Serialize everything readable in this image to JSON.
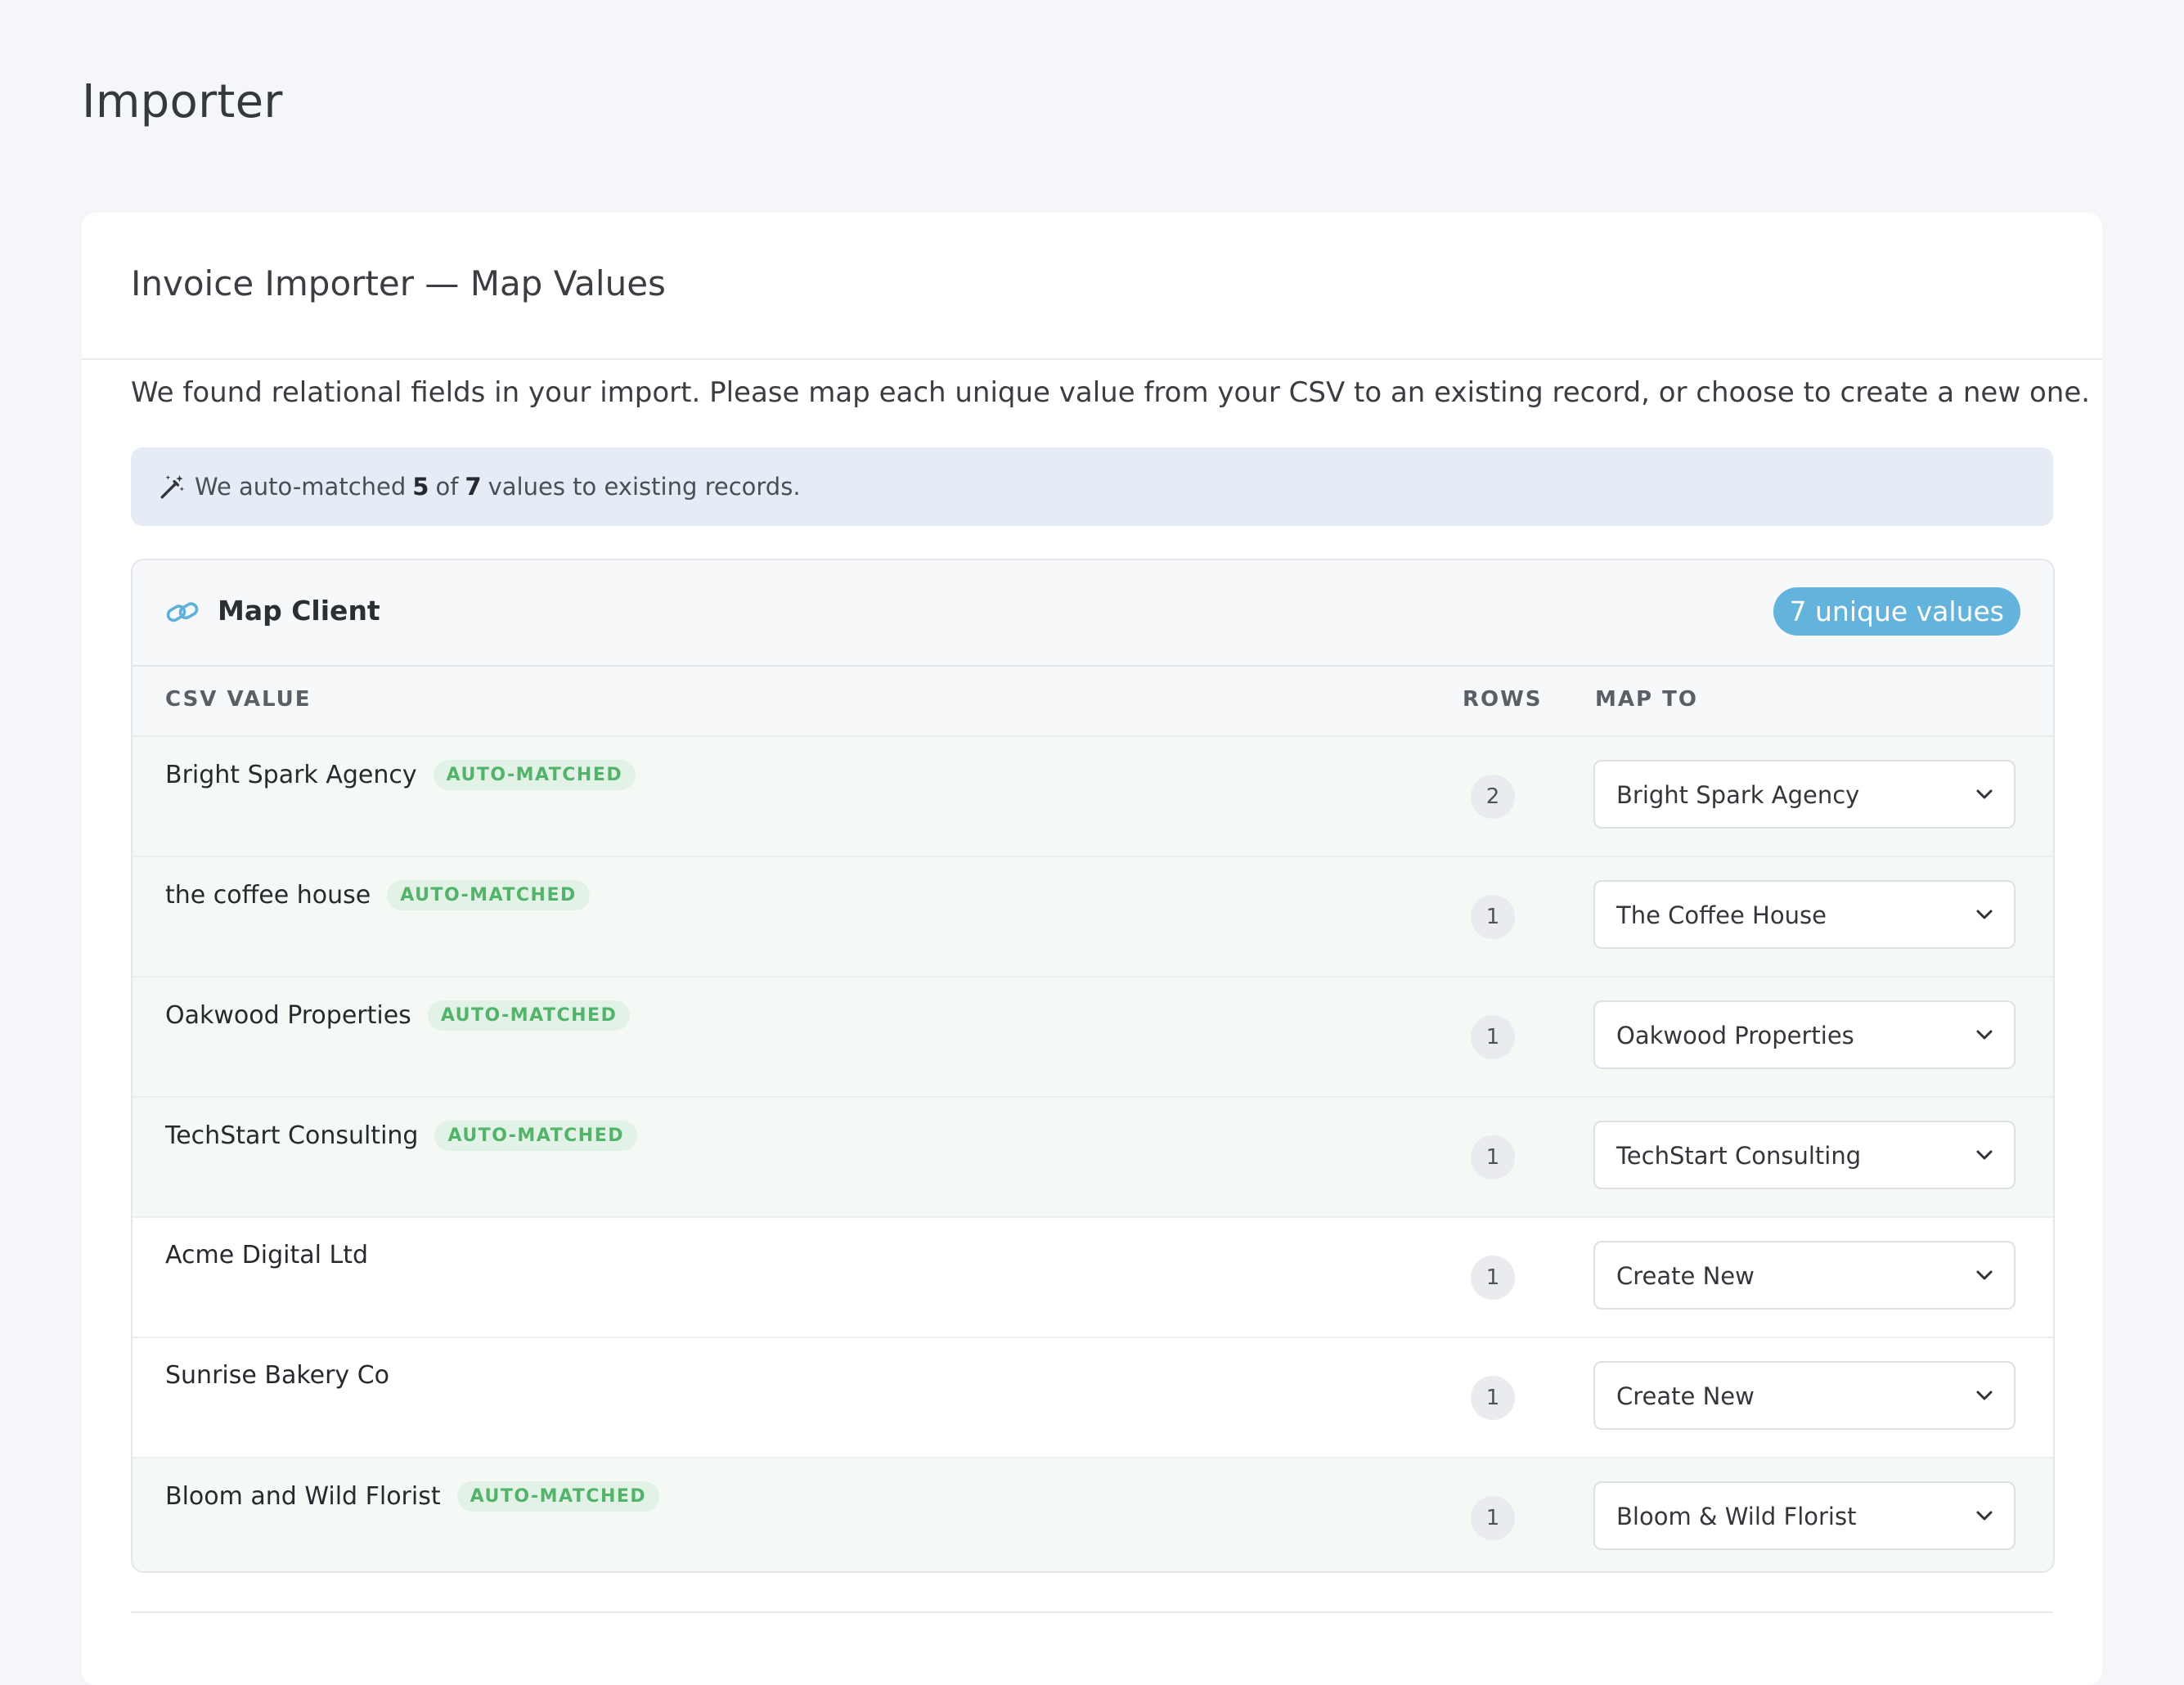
{
  "page": {
    "title": "Importer"
  },
  "card": {
    "title": "Invoice Importer — Map Values",
    "intro": "We found relational fields in your import. Please map each unique value from your CSV to an existing record, or choose to create a new one."
  },
  "alert": {
    "icon": "magic-wand-icon",
    "prefix": "We auto-matched",
    "matched": "5",
    "middle": "of",
    "total": "7",
    "suffix": "values to existing records."
  },
  "panel": {
    "icon": "link-icon",
    "title": "Map Client",
    "badge": "7 unique values",
    "columns": {
      "csv": "CSV VALUE",
      "rows": "ROWS",
      "map_to": "MAP TO"
    },
    "auto_tag": "AUTO-MATCHED",
    "rows": [
      {
        "csv": "Bright Spark Agency",
        "matched": true,
        "tag": "AUTO-MATCHED",
        "count": "2",
        "map_to": "Bright Spark Agency"
      },
      {
        "csv": "the coffee house",
        "matched": true,
        "tag": "AUTO-MATCHED",
        "count": "1",
        "map_to": "The Coffee House"
      },
      {
        "csv": "Oakwood Properties",
        "matched": true,
        "tag": "AUTO-MATCHED",
        "count": "1",
        "map_to": "Oakwood Properties"
      },
      {
        "csv": "TechStart Consulting",
        "matched": true,
        "tag": "AUTO-MATCHED",
        "count": "1",
        "map_to": "TechStart Consulting"
      },
      {
        "csv": "Acme Digital Ltd",
        "matched": false,
        "tag": "",
        "count": "1",
        "map_to": "Create New"
      },
      {
        "csv": "Sunrise Bakery Co",
        "matched": false,
        "tag": "",
        "count": "1",
        "map_to": "Create New"
      },
      {
        "csv": "Bloom and Wild Florist",
        "matched": true,
        "tag": "AUTO-MATCHED",
        "count": "1",
        "map_to": "Bloom & Wild Florist"
      }
    ]
  },
  "colors": {
    "badge": "#63b3dc",
    "matched_tag": "#53b36a",
    "matched_row_bg": "#f5f9f6",
    "alert_bg": "#e5ecf6"
  }
}
